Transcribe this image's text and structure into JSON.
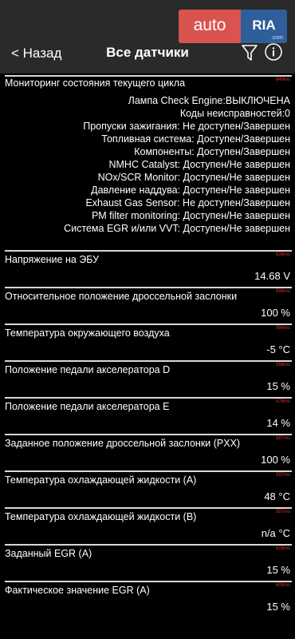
{
  "header": {
    "back_label": "< Назад",
    "title": "Все датчики",
    "logo_left": "auto",
    "logo_right": "RIA",
    "logo_sub": ".com"
  },
  "monitor": {
    "title": "Мониторинг состояния текущего цикла",
    "latency": "649ms",
    "lines": [
      "Лампа Check Engine:ВЫКЛЮЧЕНА",
      "Коды неисправностей:0",
      "Пропуски зажигания: Не доступен/Завершен",
      "Топливная система: Доступен/Завершен",
      "Компоненты: Доступен/Завершен",
      "NMHC Catalyst: Доступен/Не завершен",
      "NOx/SCR Monitor: Доступен/Не завершен",
      "Давление наддува: Доступен/Не завершен",
      "Exhaust Gas Sensor: Не доступен/Завершен",
      "PM filter monitoring: Доступен/Не завершен",
      "Система EGR и/или VVT: Доступен/Не завершен"
    ]
  },
  "sensors": [
    {
      "label": "Напряжение на ЭБУ",
      "value": "14.68 V",
      "latency": "639ms"
    },
    {
      "label": "Относительное положение дроссельной заслонки",
      "value": "100 %",
      "latency": "596ms"
    },
    {
      "label": "Температура окружающего воздуха",
      "value": "-5 °C",
      "latency": "566ms"
    },
    {
      "label": "Положение педали акселератора D",
      "value": "15 %",
      "latency": "566ms"
    },
    {
      "label": "Положение педали акселератора E",
      "value": "14 %",
      "latency": "576ms"
    },
    {
      "label": "Заданное положение дроссельной заслонки (PXX)",
      "value": "100 %",
      "latency": "587ms"
    },
    {
      "label": "Температура охлаждающей жидкости (A)",
      "value": "48 °C",
      "latency": "597ms"
    },
    {
      "label": "Температура охлаждающей жидкости (B)",
      "value": "n/a °C",
      "latency": "597ms"
    },
    {
      "label": "Заданный EGR (A)",
      "value": "15 %",
      "latency": "628ms"
    },
    {
      "label": "Фактическое значение EGR (A)",
      "value": "15 %",
      "latency": "608ms"
    }
  ],
  "colors": {
    "background": "#000000",
    "header": "#2a2a2a",
    "latency": "#e0302a",
    "separator": "#d8d8d8"
  }
}
